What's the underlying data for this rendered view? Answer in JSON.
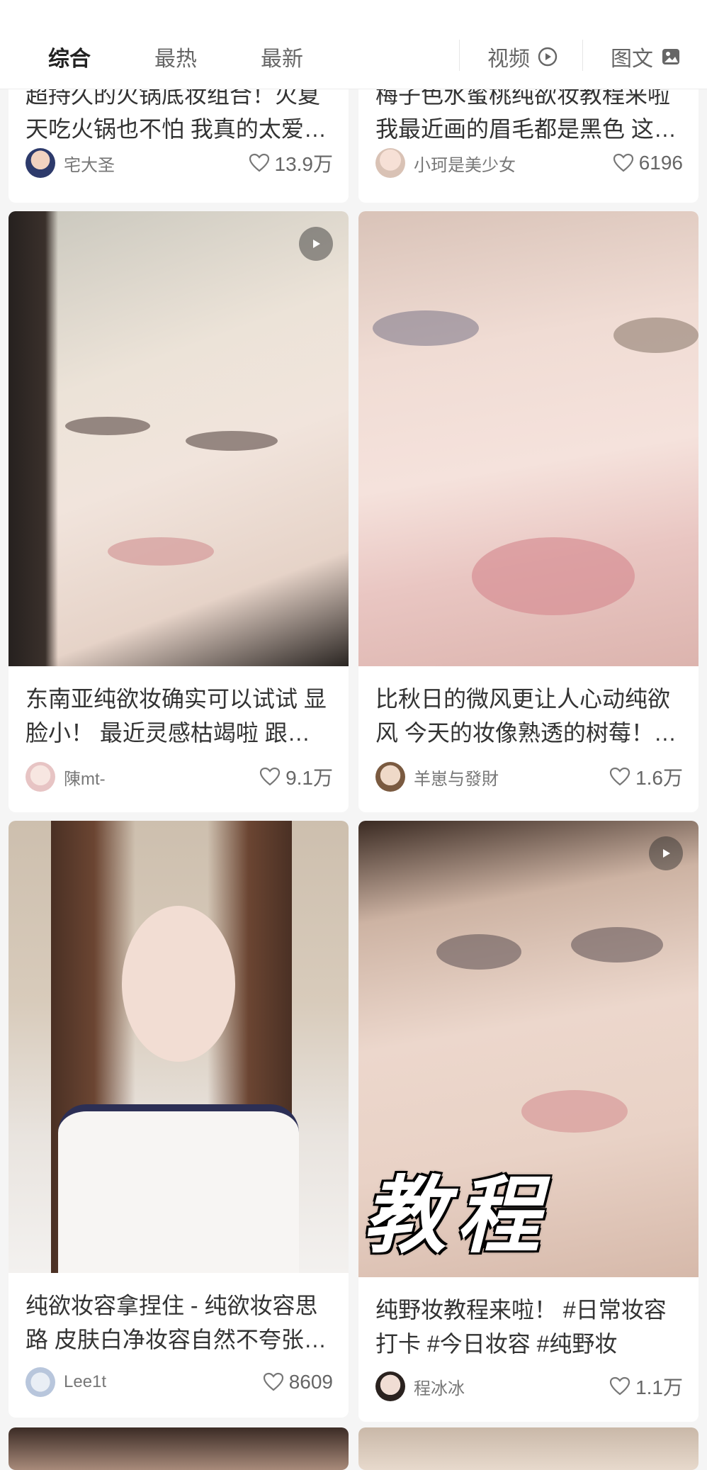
{
  "tabs": [
    {
      "label": "综合",
      "active": true
    },
    {
      "label": "最热",
      "active": false
    },
    {
      "label": "最新",
      "active": false
    }
  ],
  "filters": [
    {
      "label": "视频",
      "icon": "play-circle-icon"
    },
    {
      "label": "图文",
      "icon": "image-icon"
    }
  ],
  "cards": [
    {
      "title": "超持久的火锅底妆组合！火夏天吃火锅也不怕 我真的太爱…",
      "author": "宅大圣",
      "likes": "13.9万"
    },
    {
      "title": "梅子色水蜜桃纯欲妆教程来啦 我最近画的眉毛都是黑色 这…",
      "author": "小珂是美少女",
      "likes": "6196"
    },
    {
      "title": "东南亚纯欲妆确实可以试试 显脸小！ 最近灵感枯竭啦 跟…",
      "author": "陳mt-",
      "likes": "9.1万",
      "video": true
    },
    {
      "title": "比秋日的微风更让人心动纯欲风 今天的妆像熟透的树莓！…",
      "author": "羊崽与發財",
      "likes": "1.6万"
    },
    {
      "title": "纯欲妆容拿捏住 - 纯欲妆容思路 皮肤白净妆容自然不夸张…",
      "author": "Lee1t",
      "likes": "8609"
    },
    {
      "title": "纯野妆教程来啦！ #日常妆容打卡 #今日妆容 #纯野妆",
      "author": "程冰冰",
      "likes": "1.1万",
      "video": true,
      "overlay_text": "教程"
    }
  ],
  "colors": {
    "accent": "#222222",
    "text": "#333333",
    "muted": "#777777",
    "background": "#f5f5f5"
  }
}
